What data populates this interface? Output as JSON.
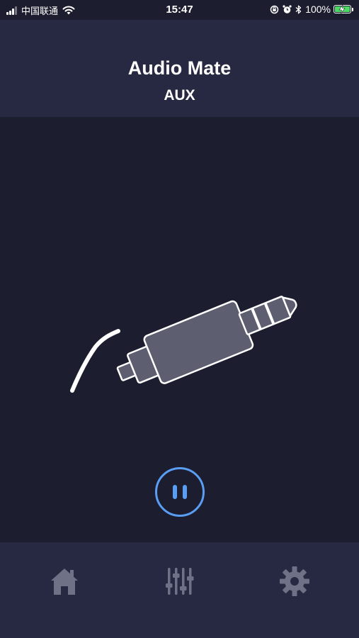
{
  "status_bar": {
    "carrier": "中国联通",
    "time": "15:47",
    "battery_percent": "100%"
  },
  "header": {
    "title": "Audio Mate",
    "subtitle": "AUX"
  },
  "main": {
    "illustration_icon": "aux-cable-icon",
    "playback_state": "playing",
    "control_icon": "pause-icon"
  },
  "tabbar": {
    "tabs": [
      {
        "icon": "home-icon"
      },
      {
        "icon": "equalizer-icon"
      },
      {
        "icon": "gear-icon"
      }
    ]
  },
  "colors": {
    "background": "#1c1d2e",
    "header_background": "#272841",
    "accent": "#5a9ef4",
    "icon_gray": "#6f7287",
    "plug_fill": "#5d5e70"
  }
}
